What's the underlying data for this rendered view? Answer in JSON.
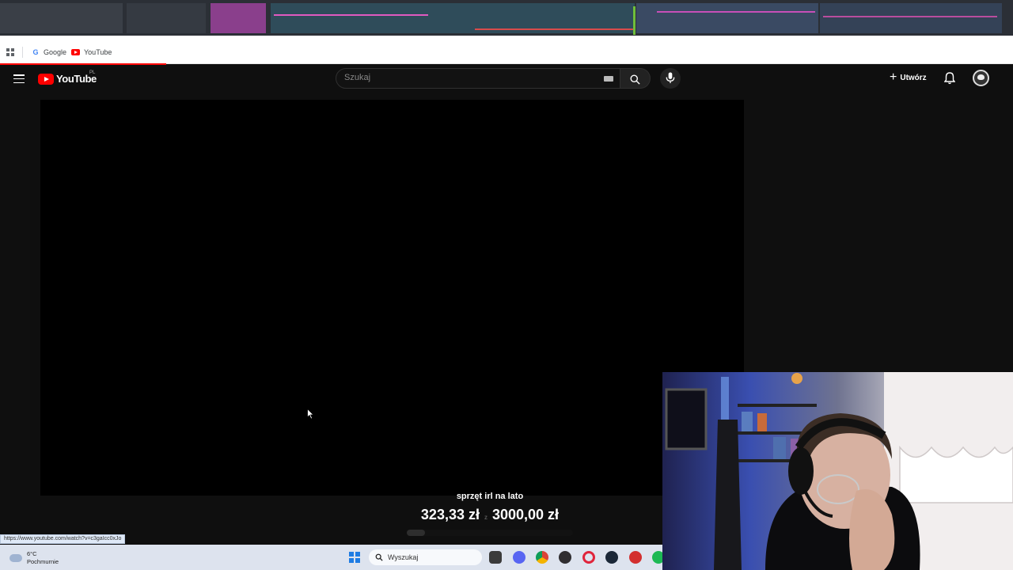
{
  "bookmarks": {
    "items": [
      {
        "label": "Google",
        "icon": "google-icon"
      },
      {
        "label": "YouTube",
        "icon": "youtube-icon"
      }
    ]
  },
  "masthead": {
    "logo_text": "YouTube",
    "country_code": "PL",
    "search_placeholder": "Szukaj",
    "create_label": "Utwórz"
  },
  "goal": {
    "title": "sprzęt irl na lato",
    "current": "323,33 zł",
    "separator": "z",
    "target": "3000,00 zł",
    "progress_fraction": 0.108
  },
  "status_bar": {
    "url": "https://www.youtube.com/watch?v=c3gaIcc0xJo"
  },
  "taskbar": {
    "weather_temp": "6°C",
    "weather_desc": "Pochmurnie",
    "search_label": "Wyszukaj",
    "apps": [
      "file-explorer-icon",
      "discord-icon",
      "chrome-icon",
      "obs-icon",
      "opera-icon",
      "steam-icon",
      "video-app-icon",
      "spotify-icon"
    ]
  },
  "colors": {
    "youtube_red": "#ff0000",
    "background": "#0f0f0f",
    "taskbar": "#dde3ee"
  }
}
